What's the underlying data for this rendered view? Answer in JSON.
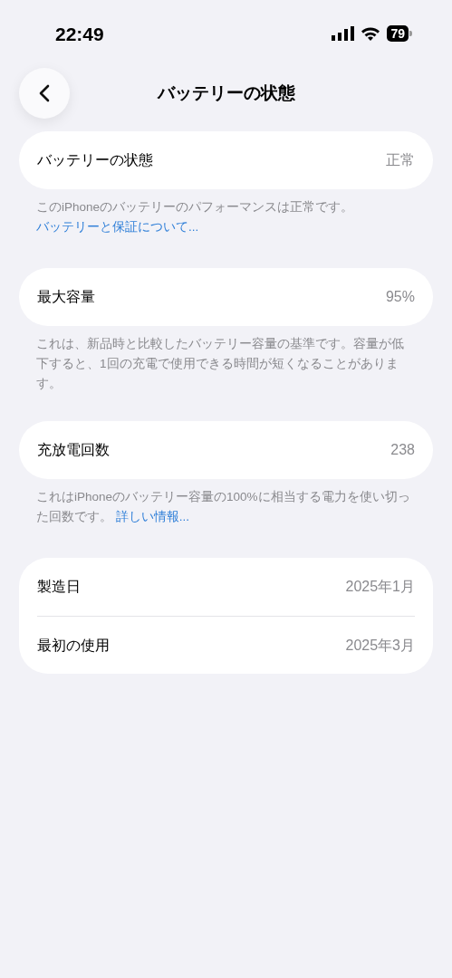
{
  "status_bar": {
    "time": "22:49",
    "battery": "79"
  },
  "nav": {
    "title": "バッテリーの状態"
  },
  "sections": [
    {
      "rows": [
        {
          "label": "バッテリーの状態",
          "value": "正常"
        }
      ],
      "footer": {
        "text": "このiPhoneのバッテリーのパフォーマンスは正常です。",
        "link": "バッテリーと保証について..."
      }
    },
    {
      "rows": [
        {
          "label": "最大容量",
          "value": "95%"
        }
      ],
      "footer": {
        "text": "これは、新品時と比較したバッテリー容量の基準です。容量が低下すると、1回の充電で使用できる時間が短くなることがあります。"
      }
    },
    {
      "rows": [
        {
          "label": "充放電回数",
          "value": "238"
        }
      ],
      "footer": {
        "text": "これはiPhoneのバッテリー容量の100%に相当する電力を使い切った回数です。",
        "link": "詳しい情報..."
      }
    },
    {
      "rows": [
        {
          "label": "製造日",
          "value": "2025年1月"
        },
        {
          "label": "最初の使用",
          "value": "2025年3月"
        }
      ]
    }
  ]
}
